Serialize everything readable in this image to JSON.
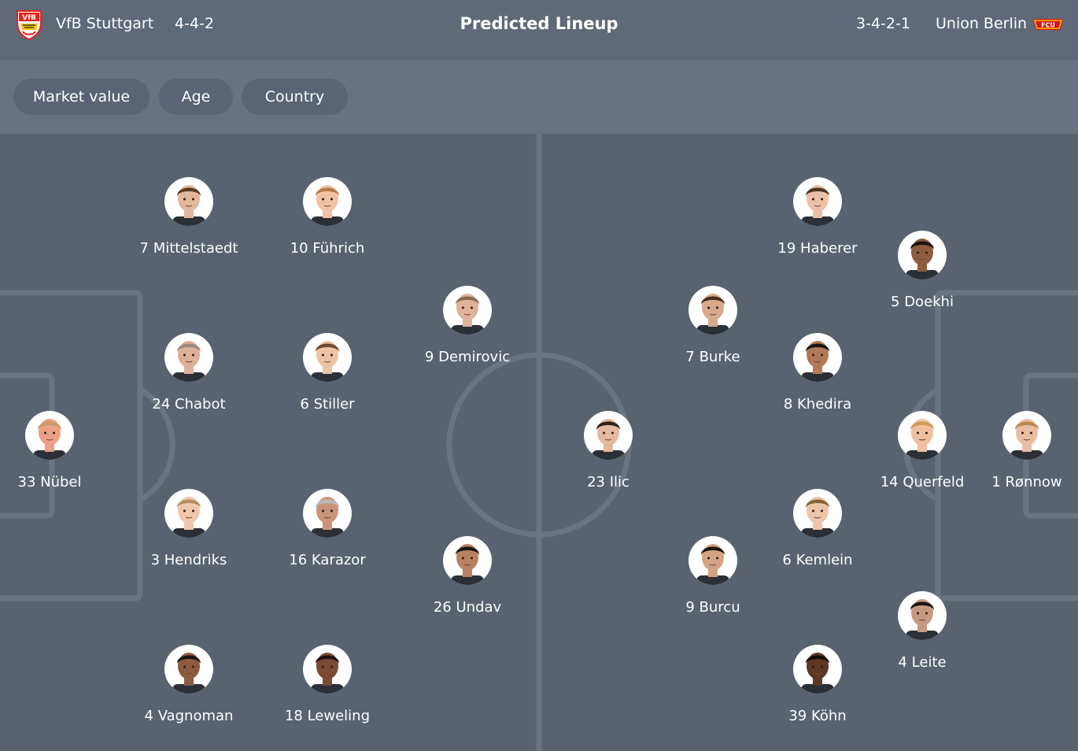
{
  "header": {
    "home_team": "VfB Stuttgart",
    "home_formation": "4-4-2",
    "title": "Predicted Lineup",
    "away_formation": "3-4-2-1",
    "away_team": "Union Berlin",
    "home_crest_text": "VfB",
    "away_crest_text": "FCU"
  },
  "filters": [
    "Market value",
    "Age",
    "Country"
  ],
  "colors": {
    "background": "#5b6573",
    "pitch": "#59636f",
    "header": "#5f6977",
    "chip": "#5a6472",
    "lines": "#6b7582",
    "vfb_red": "#e32219",
    "union_red": "#d4121a",
    "union_gold": "#f5c400"
  },
  "home_players": [
    {
      "label": "7 Mittelstaedt",
      "skin": "#e2b79c",
      "hair": "#5b3b24"
    },
    {
      "label": "10 Führich",
      "skin": "#f0c1a4",
      "hair": "#b97a47"
    },
    {
      "label": "9 Demirovic",
      "skin": "#dfb399",
      "hair": "#8a6a4e"
    },
    {
      "label": "24 Chabot",
      "skin": "#dcb098",
      "hair": "#9a8a80"
    },
    {
      "label": "6 Stiller",
      "skin": "#eec2a5",
      "hair": "#6a4a30"
    },
    {
      "label": "33 Nübel",
      "skin": "#ee9f85",
      "hair": "#c99a6a"
    },
    {
      "label": "3 Hendriks",
      "skin": "#f0c7ac",
      "hair": "#b48e64"
    },
    {
      "label": "16 Karazor",
      "skin": "#c9947a",
      "hair": "#b8b8b8"
    },
    {
      "label": "26 Undav",
      "skin": "#b98264",
      "hair": "#1d1612"
    },
    {
      "label": "4 Vagnoman",
      "skin": "#8d5a40",
      "hair": "#1b1410"
    },
    {
      "label": "18 Leweling",
      "skin": "#7a4a34",
      "hair": "#1b1410"
    }
  ],
  "away_players": [
    {
      "label": "19 Haberer",
      "skin": "#ecc1a6",
      "hair": "#4d3525"
    },
    {
      "label": "5 Doekhi",
      "skin": "#8f5b3f",
      "hair": "#1a1310"
    },
    {
      "label": "7 Burke",
      "skin": "#d9a98c",
      "hair": "#4a3020"
    },
    {
      "label": "8 Khedira",
      "skin": "#b07a58",
      "hair": "#1a1310"
    },
    {
      "label": "23 Ilic",
      "skin": "#e3b89e",
      "hair": "#2f2119"
    },
    {
      "label": "14 Querfeld",
      "skin": "#efc0a0",
      "hair": "#d39a5a"
    },
    {
      "label": "1 Rønnow",
      "skin": "#ebbda0",
      "hair": "#b9884f"
    },
    {
      "label": "6 Kemlein",
      "skin": "#eec4a8",
      "hair": "#8a6038"
    },
    {
      "label": "9 Burcu",
      "skin": "#d3a282",
      "hair": "#1d1510"
    },
    {
      "label": "4 Leite",
      "skin": "#c79a80",
      "hair": "#1b1410"
    },
    {
      "label": "39 Köhn",
      "skin": "#5e3724",
      "hair": "#120d0a"
    }
  ]
}
